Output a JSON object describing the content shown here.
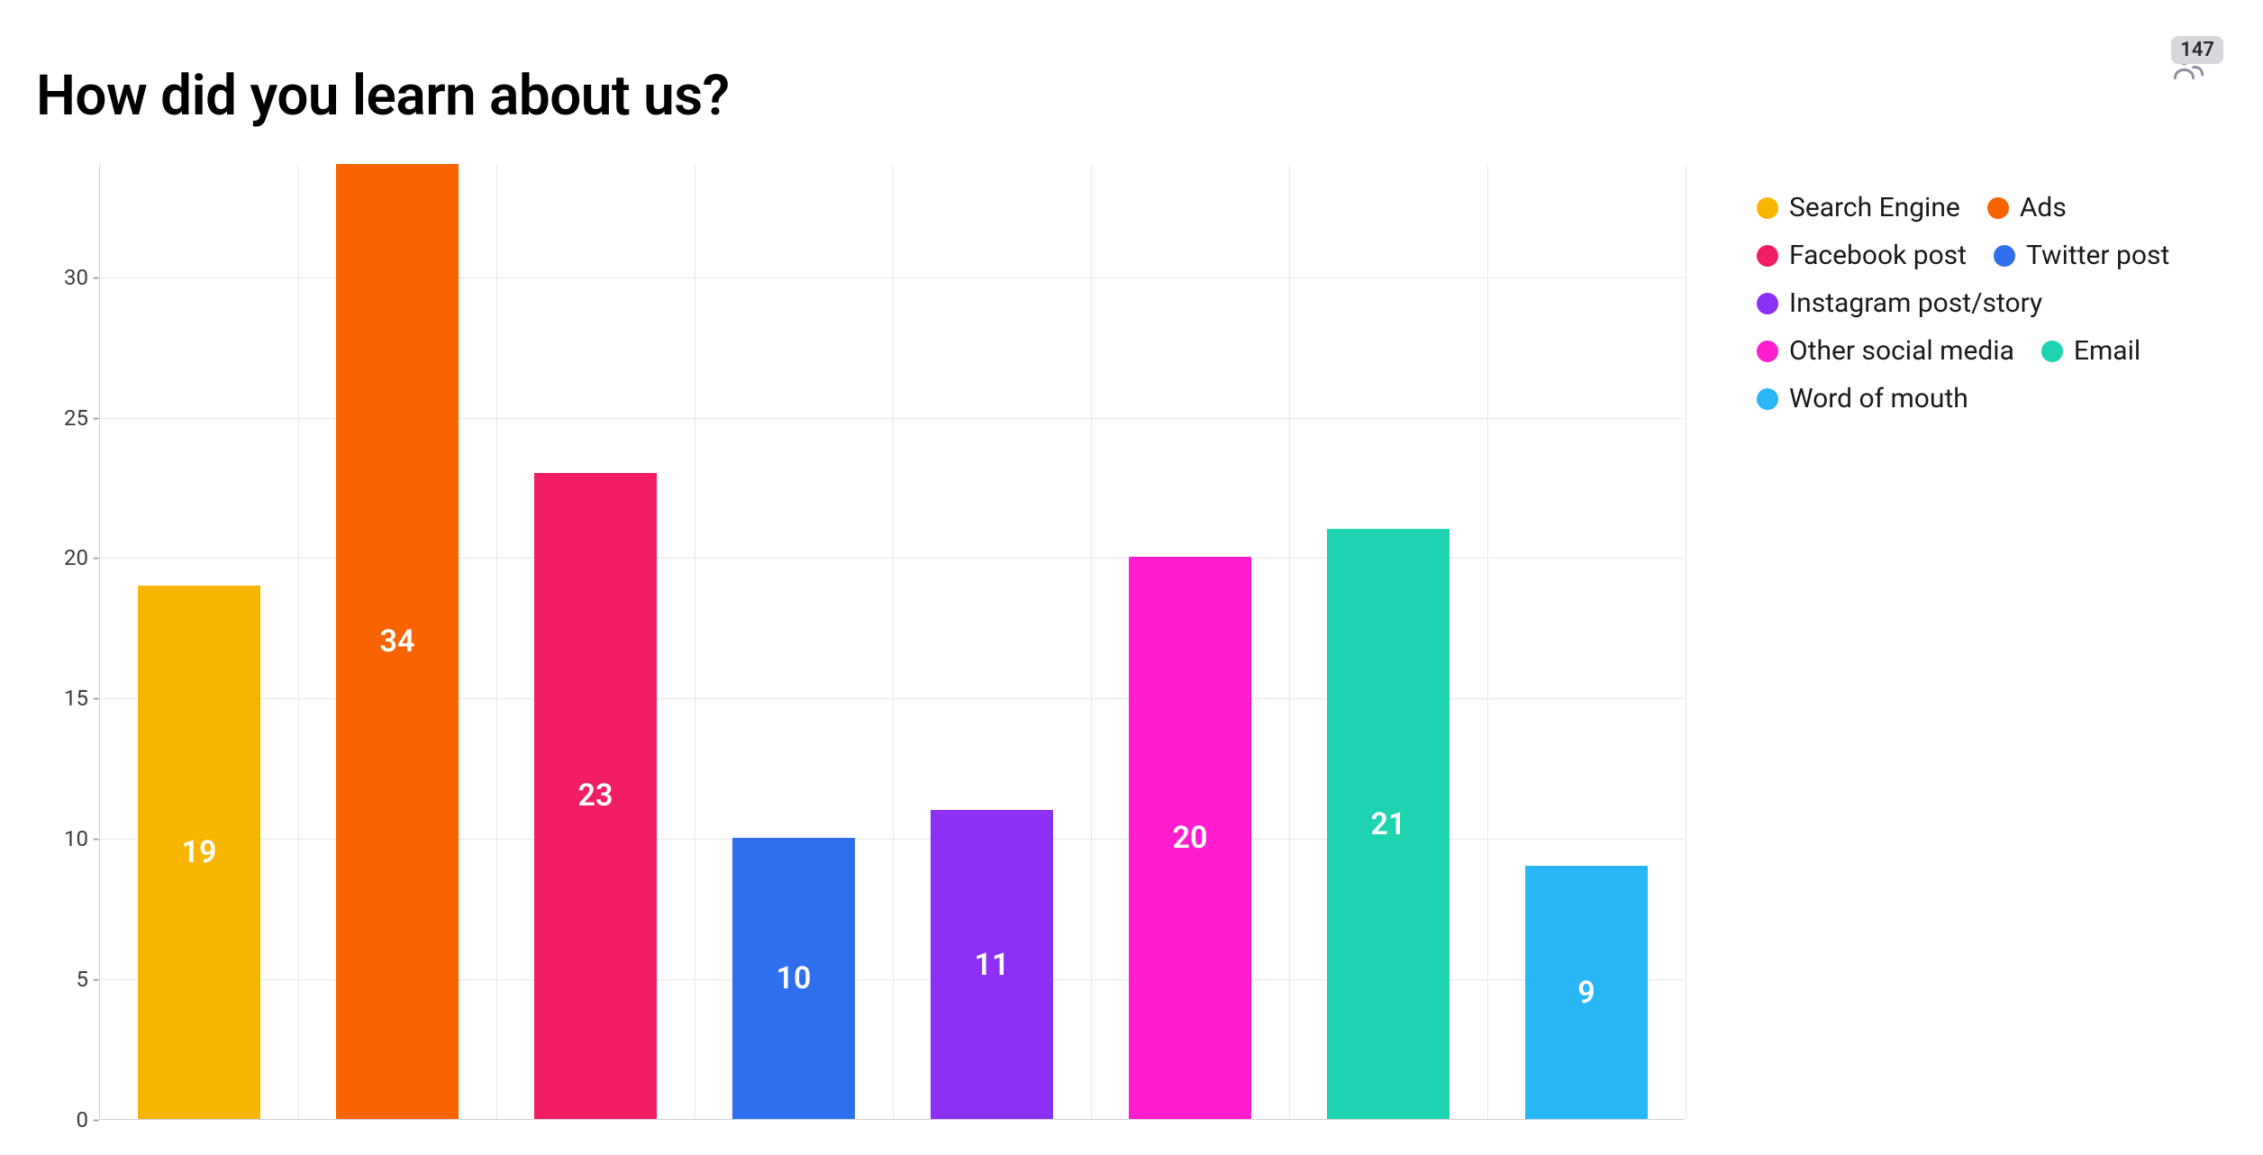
{
  "title": "How did you learn about us?",
  "respondent_count": "147",
  "chart_data": {
    "type": "bar",
    "title": "How did you learn about us?",
    "xlabel": "",
    "ylabel": "",
    "ylim": [
      0,
      34
    ],
    "yticks": [
      0,
      5,
      10,
      15,
      20,
      25,
      30
    ],
    "categories": [
      "Search Engine",
      "Ads",
      "Facebook post",
      "Twitter post",
      "Instagram post/story",
      "Other social media",
      "Email",
      "Word of mouth"
    ],
    "values": [
      19,
      34,
      23,
      10,
      11,
      20,
      21,
      9
    ],
    "series": [
      {
        "name": "Search Engine",
        "value": 19,
        "color": "#f7b500"
      },
      {
        "name": "Ads",
        "value": 34,
        "color": "#fa6400"
      },
      {
        "name": "Facebook post",
        "value": 23,
        "color": "#f31d63"
      },
      {
        "name": "Twitter post",
        "value": 10,
        "color": "#2f6fed"
      },
      {
        "name": "Instagram post/story",
        "value": 11,
        "color": "#8c30f5"
      },
      {
        "name": "Other social media",
        "value": 20,
        "color": "#ff1dce"
      },
      {
        "name": "Email",
        "value": 21,
        "color": "#1dd3b0"
      },
      {
        "name": "Word of mouth",
        "value": 9,
        "color": "#29b6f6"
      }
    ]
  }
}
